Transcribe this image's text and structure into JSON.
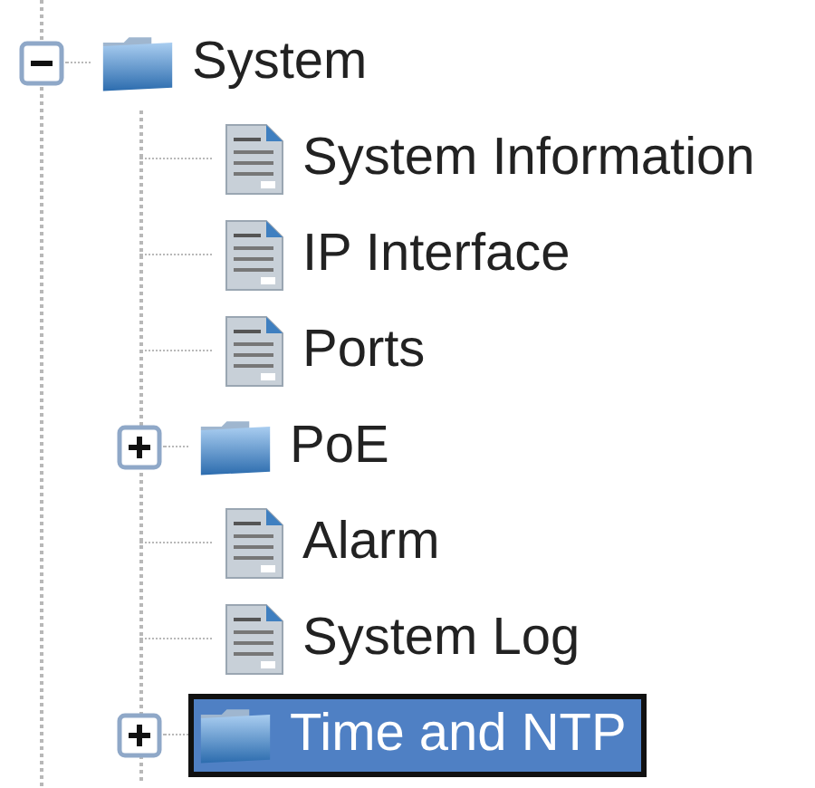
{
  "tree": [
    {
      "label": "System",
      "kind": "folder",
      "expanded": true,
      "selected": false,
      "children": [
        {
          "label": "System Information",
          "kind": "page",
          "selected": false
        },
        {
          "label": "IP Interface",
          "kind": "page",
          "selected": false
        },
        {
          "label": "Ports",
          "kind": "page",
          "selected": false
        },
        {
          "label": "PoE",
          "kind": "folder",
          "expanded": false,
          "selected": false
        },
        {
          "label": "Alarm",
          "kind": "page",
          "selected": false
        },
        {
          "label": "System Log",
          "kind": "page",
          "selected": false
        },
        {
          "label": "Time and NTP",
          "kind": "folder",
          "expanded": false,
          "selected": true
        }
      ]
    }
  ]
}
